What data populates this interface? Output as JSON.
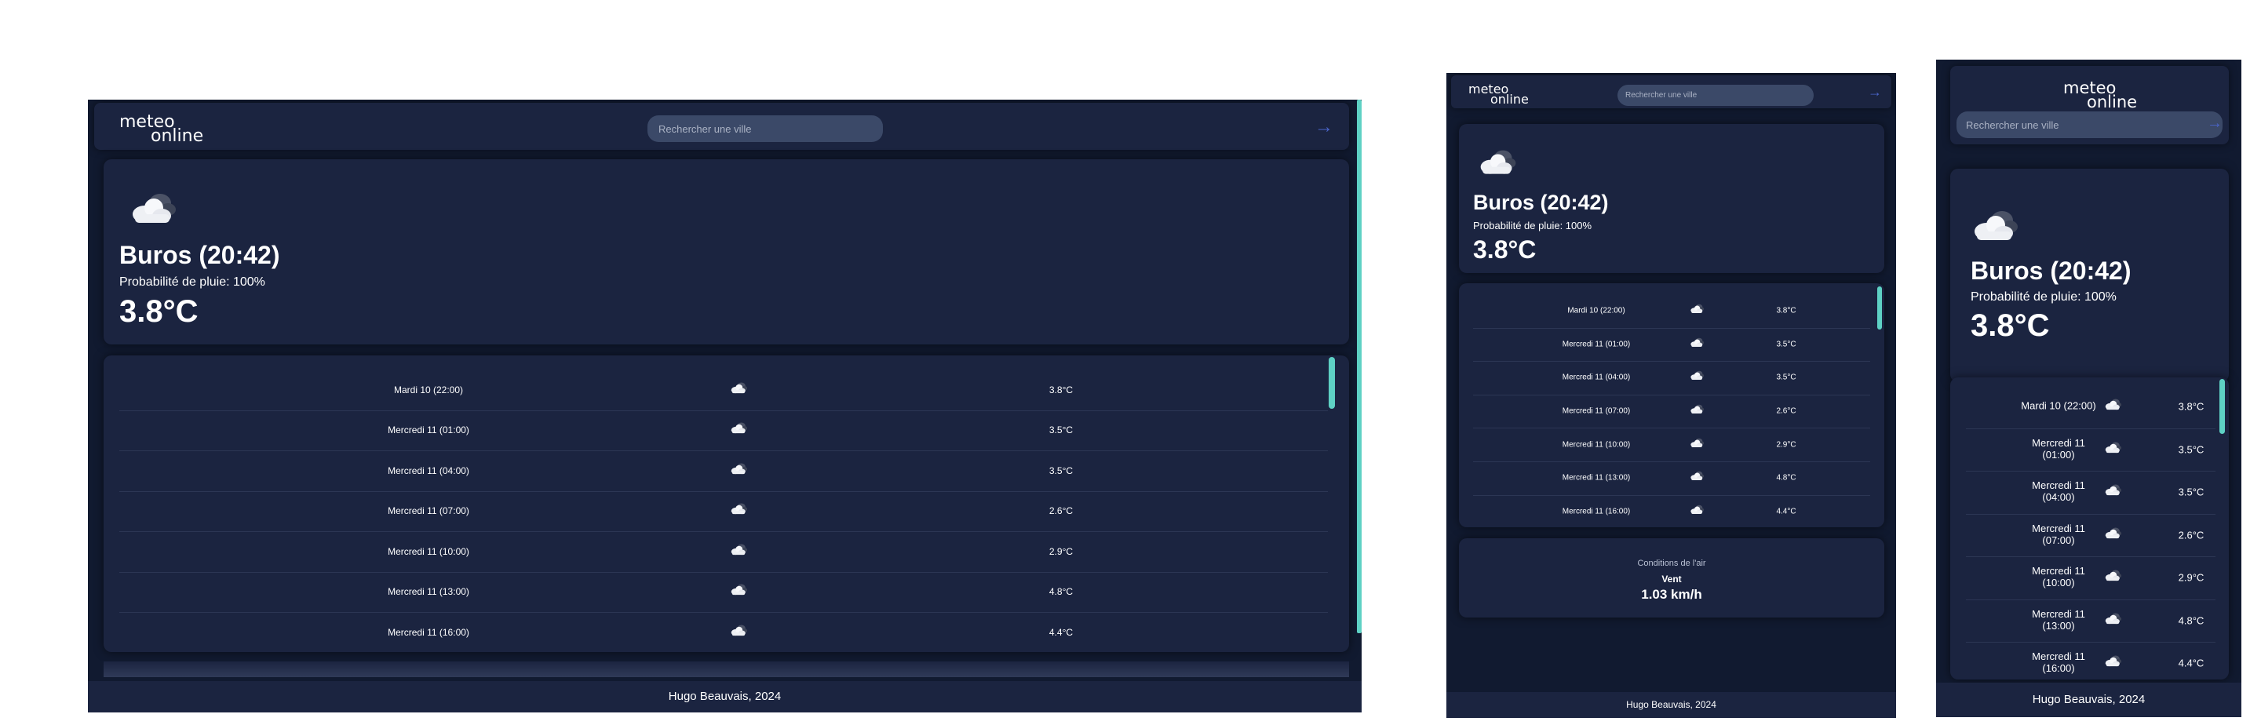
{
  "app": {
    "logo_line1": "meteo",
    "logo_line2": "online",
    "search_placeholder": "Rechercher une ville",
    "search_arrow": "→"
  },
  "current": {
    "city": "Buros (20:42)",
    "rain": "Probabilité de pluie: 100%",
    "temperature": "3.8°C",
    "icon": "cloud-icon"
  },
  "forecast": [
    {
      "time": "Mardi 10 (22:00)",
      "icon": "cloud-icon",
      "temp": "3.8°C"
    },
    {
      "time": "Mercredi 11 (01:00)",
      "icon": "cloud-icon",
      "temp": "3.5°C"
    },
    {
      "time": "Mercredi 11 (04:00)",
      "icon": "cloud-icon",
      "temp": "3.5°C"
    },
    {
      "time": "Mercredi 11 (07:00)",
      "icon": "cloud-icon",
      "temp": "2.6°C"
    },
    {
      "time": "Mercredi 11 (10:00)",
      "icon": "cloud-icon",
      "temp": "2.9°C"
    },
    {
      "time": "Mercredi 11 (13:00)",
      "icon": "cloud-icon",
      "temp": "4.8°C"
    },
    {
      "time": "Mercredi 11 (16:00)",
      "icon": "cloud-icon",
      "temp": "4.4°C"
    }
  ],
  "mobile_forecast_times": [
    {
      "line1": "Mardi 10 (22:00)",
      "line2": ""
    },
    {
      "line1": "Mercredi 11",
      "line2": "(01:00)"
    },
    {
      "line1": "Mercredi 11",
      "line2": "(04:00)"
    },
    {
      "line1": "Mercredi 11",
      "line2": "(07:00)"
    },
    {
      "line1": "Mercredi 11",
      "line2": "(10:00)"
    },
    {
      "line1": "Mercredi 11",
      "line2": "(13:00)"
    },
    {
      "line1": "Mercredi 11",
      "line2": "(16:00)"
    }
  ],
  "air": {
    "title": "Conditions de l'air",
    "wind_label": "Vent",
    "wind_value": "1.03 km/h"
  },
  "footer": "Hugo Beauvais, 2024",
  "colors": {
    "background": "#111a30",
    "card": "#1b2440",
    "accent_scrollbar": "#5ed1c4",
    "arrow": "#4a64c8"
  }
}
